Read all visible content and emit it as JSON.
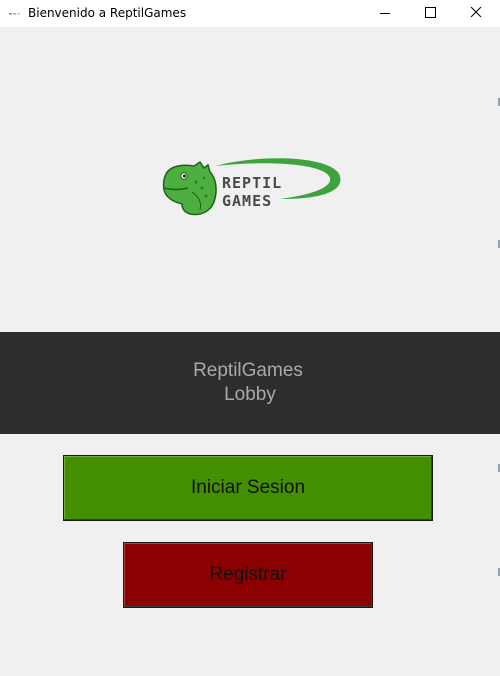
{
  "window": {
    "title": "Bienvenido a ReptilGames",
    "controls": {
      "minimize": "minimize-icon",
      "maximize": "maximize-icon",
      "close": "close-icon"
    }
  },
  "logo": {
    "line1": "REPTIL",
    "line2": "GAMES",
    "colors": {
      "green": "#3da33d",
      "text": "#4a4a4a"
    }
  },
  "banner": {
    "line1": "ReptilGames",
    "line2": "Lobby",
    "background": "#2d2d2d",
    "text_color": "#a9a9a9"
  },
  "buttons": {
    "login_label": "Iniciar Sesion",
    "login_color": "#448f00",
    "register_label": "Registrar",
    "register_color": "#8b0000"
  }
}
